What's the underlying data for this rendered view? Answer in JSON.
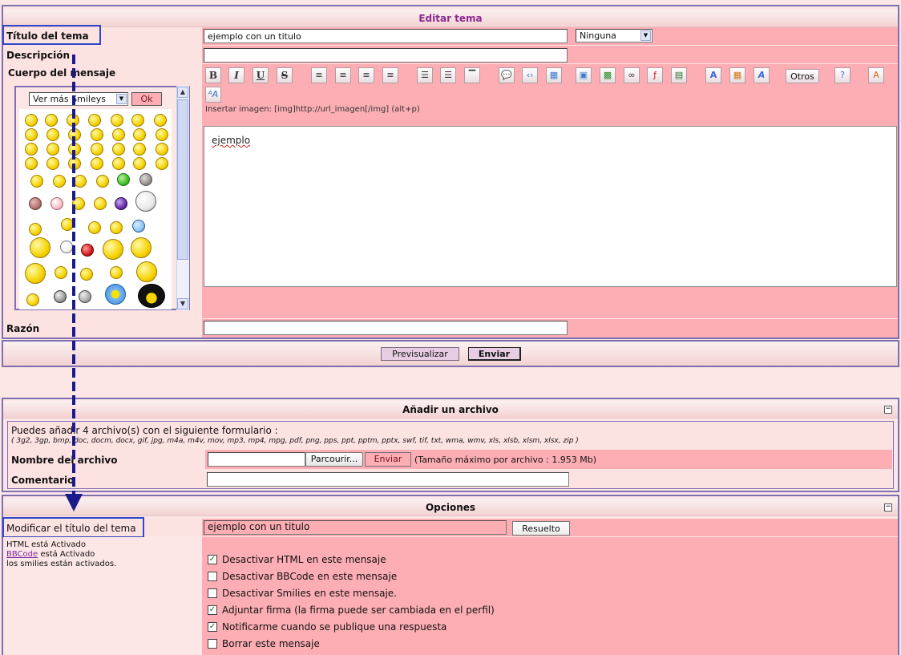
{
  "edit_panel": {
    "title": "Editar tema",
    "label_titulo": "Título del tema",
    "titulo_value": "ejemplo con un titulo",
    "icon_select_value": "Ninguna",
    "label_descripcion": "Descripción",
    "descripcion_value": "",
    "label_cuerpo": "Cuerpo del mensaje",
    "smileys_select": "Ver más Smileys",
    "smileys_ok": "Ok",
    "toolbar": {
      "bold": "B",
      "italic": "I",
      "underline": "U",
      "strike": "S",
      "otros": "Otros"
    },
    "insert_hint": "Insertar imagen: [img]http://url_imagen[/img] (alt+p)",
    "message_text": "ejemplo",
    "label_razon": "Razón",
    "razon_value": "",
    "btn_preview": "Previsualizar",
    "btn_send": "Enviar"
  },
  "attach_panel": {
    "title": "Añadir un archivo",
    "collapse": "−",
    "info": "Puedes añadir 4 archivo(s) con el siguiente formulario :",
    "extensions": "( 3g2, 3gp, bmp, doc, docm, docx, gif, jpg, m4a, m4v, mov, mp3, mp4, mpg, pdf, png, pps, ppt, pptm, pptx, swf, tif, txt, wma, wmv, xls, xlsb, xlsm, xlsx, zip )",
    "label_nombre": "Nombre del archivo",
    "btn_browse": "Parcourir...",
    "btn_upload": "Enviar",
    "max_size": "(Tamaño máximo por archivo : 1.953 Mb)",
    "label_comentario": "Comentario",
    "comentario_value": ""
  },
  "options_panel": {
    "title": "Opciones",
    "collapse": "−",
    "label_modificar": "Modificar el título del tema",
    "modificar_value": "ejemplo con un titulo",
    "btn_resuelto": "Resuelto",
    "status_html": "HTML está Activado",
    "status_bbcode_link": "BBCode",
    "status_bbcode_rest": " está Activado",
    "status_smilies": "los smilies están activados.",
    "options": [
      {
        "label": "Desactivar HTML en este mensaje",
        "checked": true
      },
      {
        "label": "Desactivar BBCode en este mensaje",
        "checked": false
      },
      {
        "label": "Desactivar Smilies en este mensaje.",
        "checked": false
      },
      {
        "label": "Adjuntar firma (la firma puede ser cambiada en el perfil)",
        "checked": true
      },
      {
        "label": "Notificarme cuando se publique una respuesta",
        "checked": true
      },
      {
        "label": "Borrar este mensaje",
        "checked": false
      }
    ],
    "check_mark": "✓"
  },
  "colors": {
    "border": "#7d6fb0",
    "pink": "#fcaeb4",
    "highlight": "#2f47c8",
    "arrow": "#1a1a8c"
  }
}
